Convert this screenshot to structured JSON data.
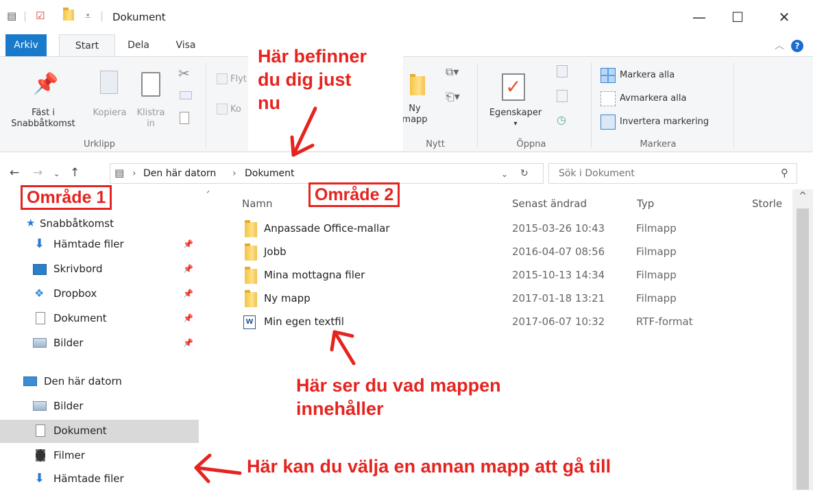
{
  "window": {
    "title": "Dokument",
    "minimize": "—",
    "maximize": "☐",
    "close": "✕"
  },
  "ribbon": {
    "tabs": [
      "Arkiv",
      "Start",
      "Dela",
      "Visa"
    ],
    "urklipp": {
      "pin": "Fäst i\nSnabbåtkomst",
      "pin_line1": "Fäst i",
      "pin_line2": "Snabbåtkomst",
      "copy": "Kopiera",
      "paste_line1": "Klistra",
      "paste_line2": "in",
      "group": "Urklipp"
    },
    "ordna": {
      "move": "Flyt",
      "copy": "Ko"
    },
    "nytt": {
      "new_folder_line1": "Ny",
      "new_folder_line2": "mapp",
      "group": "Nytt"
    },
    "oppna": {
      "properties": "Egenskaper",
      "group": "Öppna"
    },
    "markera": {
      "select_all": "Markera alla",
      "select_none": "Avmarkera alla",
      "invert": "Invertera markering",
      "group": "Markera"
    }
  },
  "address": {
    "crumbs": [
      "Den här datorn",
      "Dokument"
    ],
    "search_placeholder": "Sök i Dokument"
  },
  "nav": {
    "quick_access": "Snabbåtkomst",
    "items": [
      {
        "label": "Hämtade filer",
        "pinned": true,
        "icon": "download-icon"
      },
      {
        "label": "Skrivbord",
        "pinned": true,
        "icon": "desktop-icon"
      },
      {
        "label": "Dropbox",
        "pinned": true,
        "icon": "dropbox-icon"
      },
      {
        "label": "Dokument",
        "pinned": true,
        "icon": "document-icon"
      },
      {
        "label": "Bilder",
        "pinned": true,
        "icon": "pictures-icon"
      }
    ],
    "this_pc": "Den här datorn",
    "pc_items": [
      {
        "label": "Bilder",
        "icon": "pictures-icon"
      },
      {
        "label": "Dokument",
        "icon": "document-icon",
        "selected": true
      },
      {
        "label": "Filmer",
        "icon": "videos-icon"
      },
      {
        "label": "Hämtade filer",
        "icon": "download-icon"
      }
    ]
  },
  "files": {
    "columns": {
      "name": "Namn",
      "date": "Senast ändrad",
      "type": "Typ",
      "size": "Storle"
    },
    "rows": [
      {
        "name": "Anpassade Office-mallar",
        "date": "2015-03-26 10:43",
        "type": "Filmapp",
        "icon": "folder-icon"
      },
      {
        "name": "Jobb",
        "date": "2016-04-07 08:56",
        "type": "Filmapp",
        "icon": "folder-icon"
      },
      {
        "name": "Mina mottagna filer",
        "date": "2015-10-13 14:34",
        "type": "Filmapp",
        "icon": "folder-icon"
      },
      {
        "name": "Ny mapp",
        "date": "2017-01-18 13:21",
        "type": "Filmapp",
        "icon": "folder-icon"
      },
      {
        "name": "Min egen textfil",
        "date": "2017-06-07 10:32",
        "type": "RTF-format",
        "icon": "word-document-icon"
      }
    ]
  },
  "annotations": {
    "you_are_here_1": "Här befinner",
    "you_are_here_2": "du dig just",
    "you_are_here_3": "nu",
    "area1": "Område 1",
    "area2": "Område 2",
    "contents_1": "Här ser du vad mappen",
    "contents_2": "innehåller",
    "choose": "Här kan du välja en annan mapp att gå till",
    "color": "#e5231f"
  }
}
